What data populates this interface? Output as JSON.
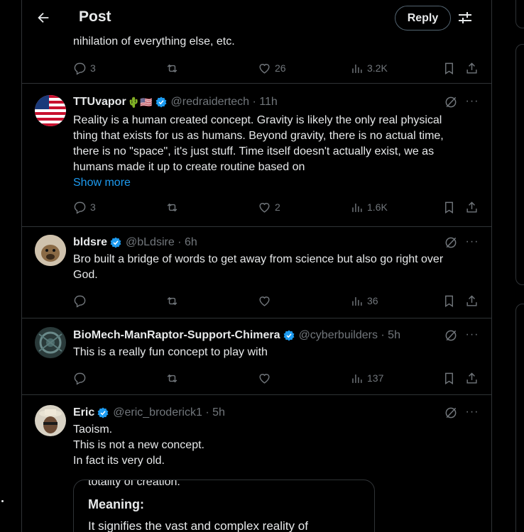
{
  "header": {
    "title": "Post",
    "reply_label": "Reply"
  },
  "top_snippet": "nihilation of everything else, etc.",
  "top_actions": {
    "replies": "3",
    "reposts": "",
    "likes": "26",
    "views": "3.2K"
  },
  "tweets": [
    {
      "name": "TTUvapor",
      "emoji": "🌵🇺🇸",
      "handle": "@redraidertech · 11h",
      "lines": [
        "Reality is a human created concept. Gravity is likely the only real physical",
        "thing that exists for us as humans. Beyond gravity, there is no actual time,",
        "there is no \"space\", it's just stuff. Time itself doesn't actually exist, we as",
        "humans made it up to create routine based on"
      ],
      "show_more": "Show more",
      "replies": "3",
      "reposts": "",
      "likes": "2",
      "views": "1.6K"
    },
    {
      "name": "bldsre",
      "handle": "@bLdsire · 6h",
      "lines": [
        "Bro built a bridge of words to get away from science but also go right over",
        "God."
      ],
      "replies": "",
      "reposts": "",
      "likes": "",
      "views": "36"
    },
    {
      "name": "BioMech-ManRaptor-Support-Chimera",
      "handle": "@cyberbuilders · 5h",
      "lines": [
        "This is a really fun concept to play with"
      ],
      "replies": "",
      "reposts": "",
      "likes": "",
      "views": "137"
    },
    {
      "name": "Eric",
      "handle": "@eric_broderick1 · 5h",
      "lines": [
        "Taoism.",
        "This is not a new concept.",
        "In fact its very old."
      ],
      "quote": {
        "clipped": "totality of creation.",
        "heading": "Meaning:",
        "text": "It signifies the vast and complex reality of"
      }
    }
  ],
  "more_label": "···",
  "colors": {
    "background": "#000000",
    "text": "#e7e9ea",
    "muted": "#71767b",
    "accent": "#1d9bf0",
    "border": "#2f3336"
  }
}
